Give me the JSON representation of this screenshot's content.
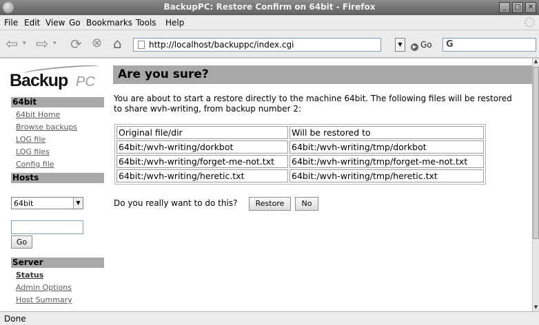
{
  "window": {
    "title": "BackupPC: Restore Confirm on 64bit - Firefox"
  },
  "menu": [
    "File",
    "Edit",
    "View",
    "Go",
    "Bookmarks",
    "Tools",
    "Help"
  ],
  "toolbar": {
    "url": "http://localhost/backuppc/index.cgi",
    "go_label": "Go",
    "search_glyph": "G"
  },
  "sidebar": {
    "logo_main": "Backup",
    "logo_pc": "PC",
    "host_heading": "64bit",
    "host_links": [
      "64bit Home",
      "Browse backups",
      "LOG file",
      "LOG files",
      "Config file"
    ],
    "hosts_heading": "Hosts",
    "host_select_value": "64bit",
    "go_button": "Go",
    "server_heading": "Server",
    "server_links": [
      "Status",
      "Admin Options",
      "Host Summary"
    ]
  },
  "main": {
    "title": "Are you sure?",
    "intro": "You are about to start a restore directly to the machine 64bit. The following files will be restored to share wvh-writing, from backup number 2:",
    "table": {
      "headers": [
        "Original file/dir",
        "Will be restored to"
      ],
      "rows": [
        [
          "64bit:/wvh-writing/dorkbot",
          "64bit:/wvh-writing/tmp/dorkbot"
        ],
        [
          "64bit:/wvh-writing/forget-me-not.txt",
          "64bit:/wvh-writing/tmp/forget-me-not.txt"
        ],
        [
          "64bit:/wvh-writing/heretic.txt",
          "64bit:/wvh-writing/tmp/heretic.txt"
        ]
      ]
    },
    "question": "Do you really want to do this?",
    "restore_button": "Restore",
    "no_button": "No"
  },
  "status": "Done"
}
